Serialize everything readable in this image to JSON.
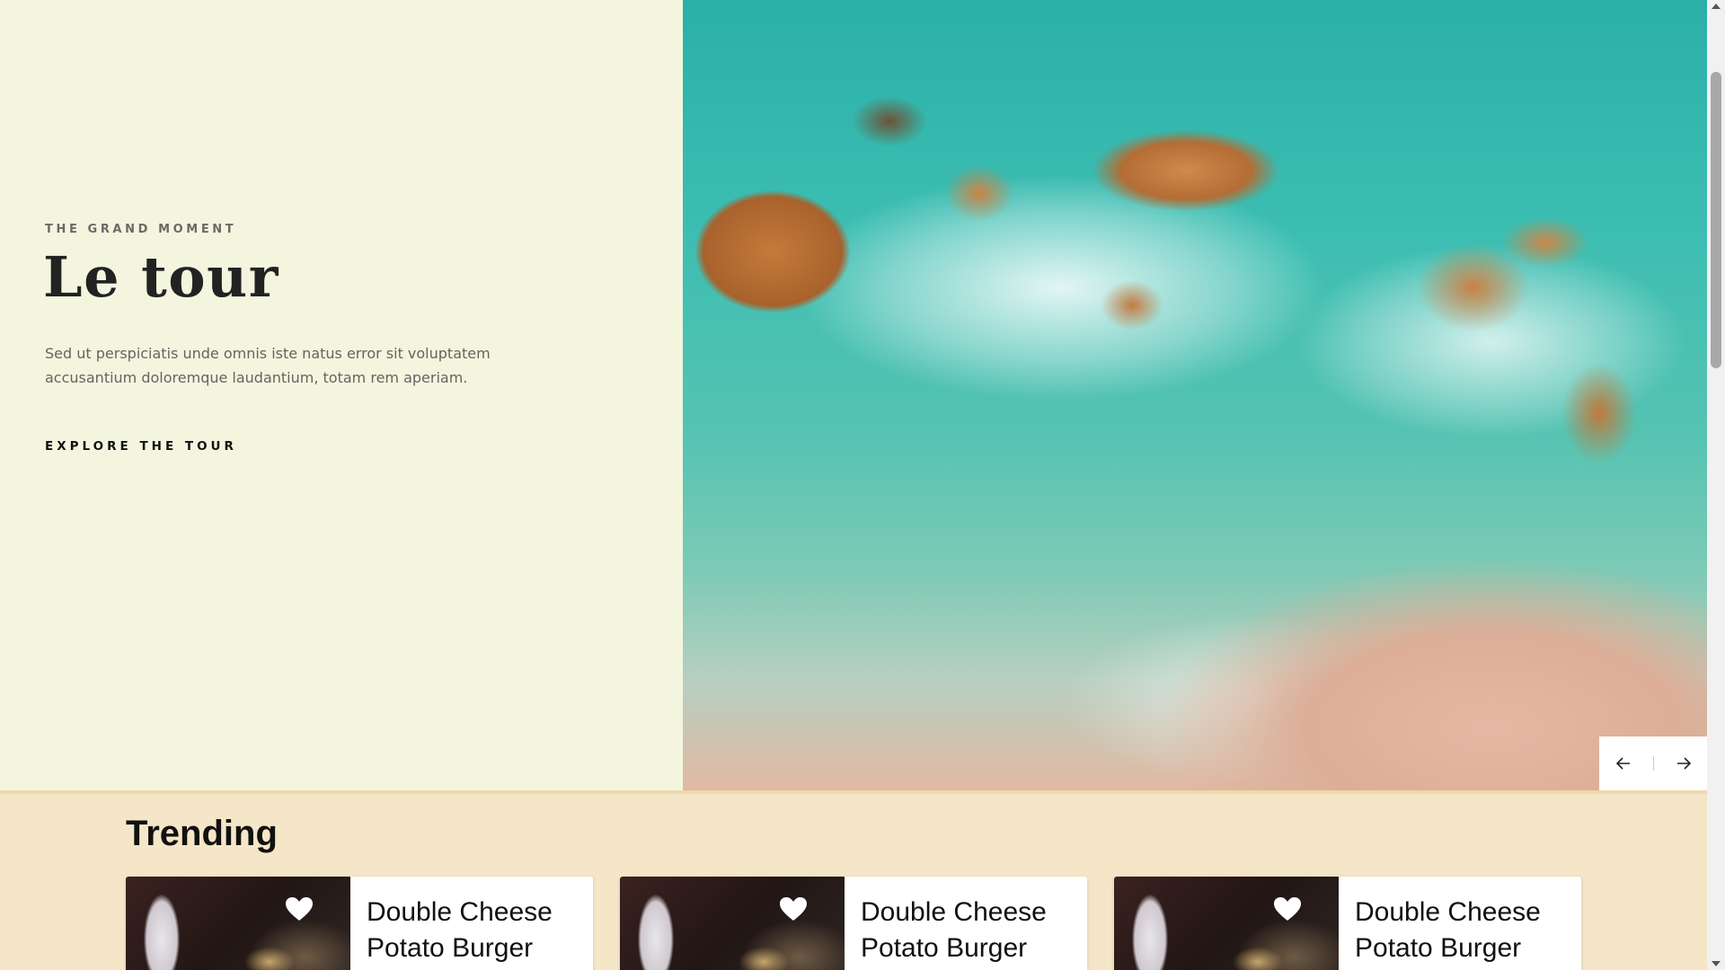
{
  "hero": {
    "eyebrow": "THE GRAND MOMENT",
    "title": "Le tour",
    "description": "Sed ut perspiciatis unde omnis iste natus error sit voluptatem accusantium doloremque laudantium, totam rem aperiam.",
    "cta": "EXPLORE THE TOUR",
    "image_icon": "aerial-beach-photo"
  },
  "slider": {
    "prev_icon": "arrow-left-icon",
    "next_icon": "arrow-right-icon"
  },
  "trending": {
    "title": "Trending",
    "cards": [
      {
        "title_line1": "Double Cheese",
        "title_line2": "Potato Burger"
      },
      {
        "title_line1": "Double Cheese",
        "title_line2": "Potato Burger"
      },
      {
        "title_line1": "Double Cheese",
        "title_line2": "Potato Burger"
      }
    ]
  },
  "colors": {
    "hero_left_bg": "#f4f5df",
    "trending_bg": "#f5e6c8",
    "text_dark": "#222222"
  }
}
